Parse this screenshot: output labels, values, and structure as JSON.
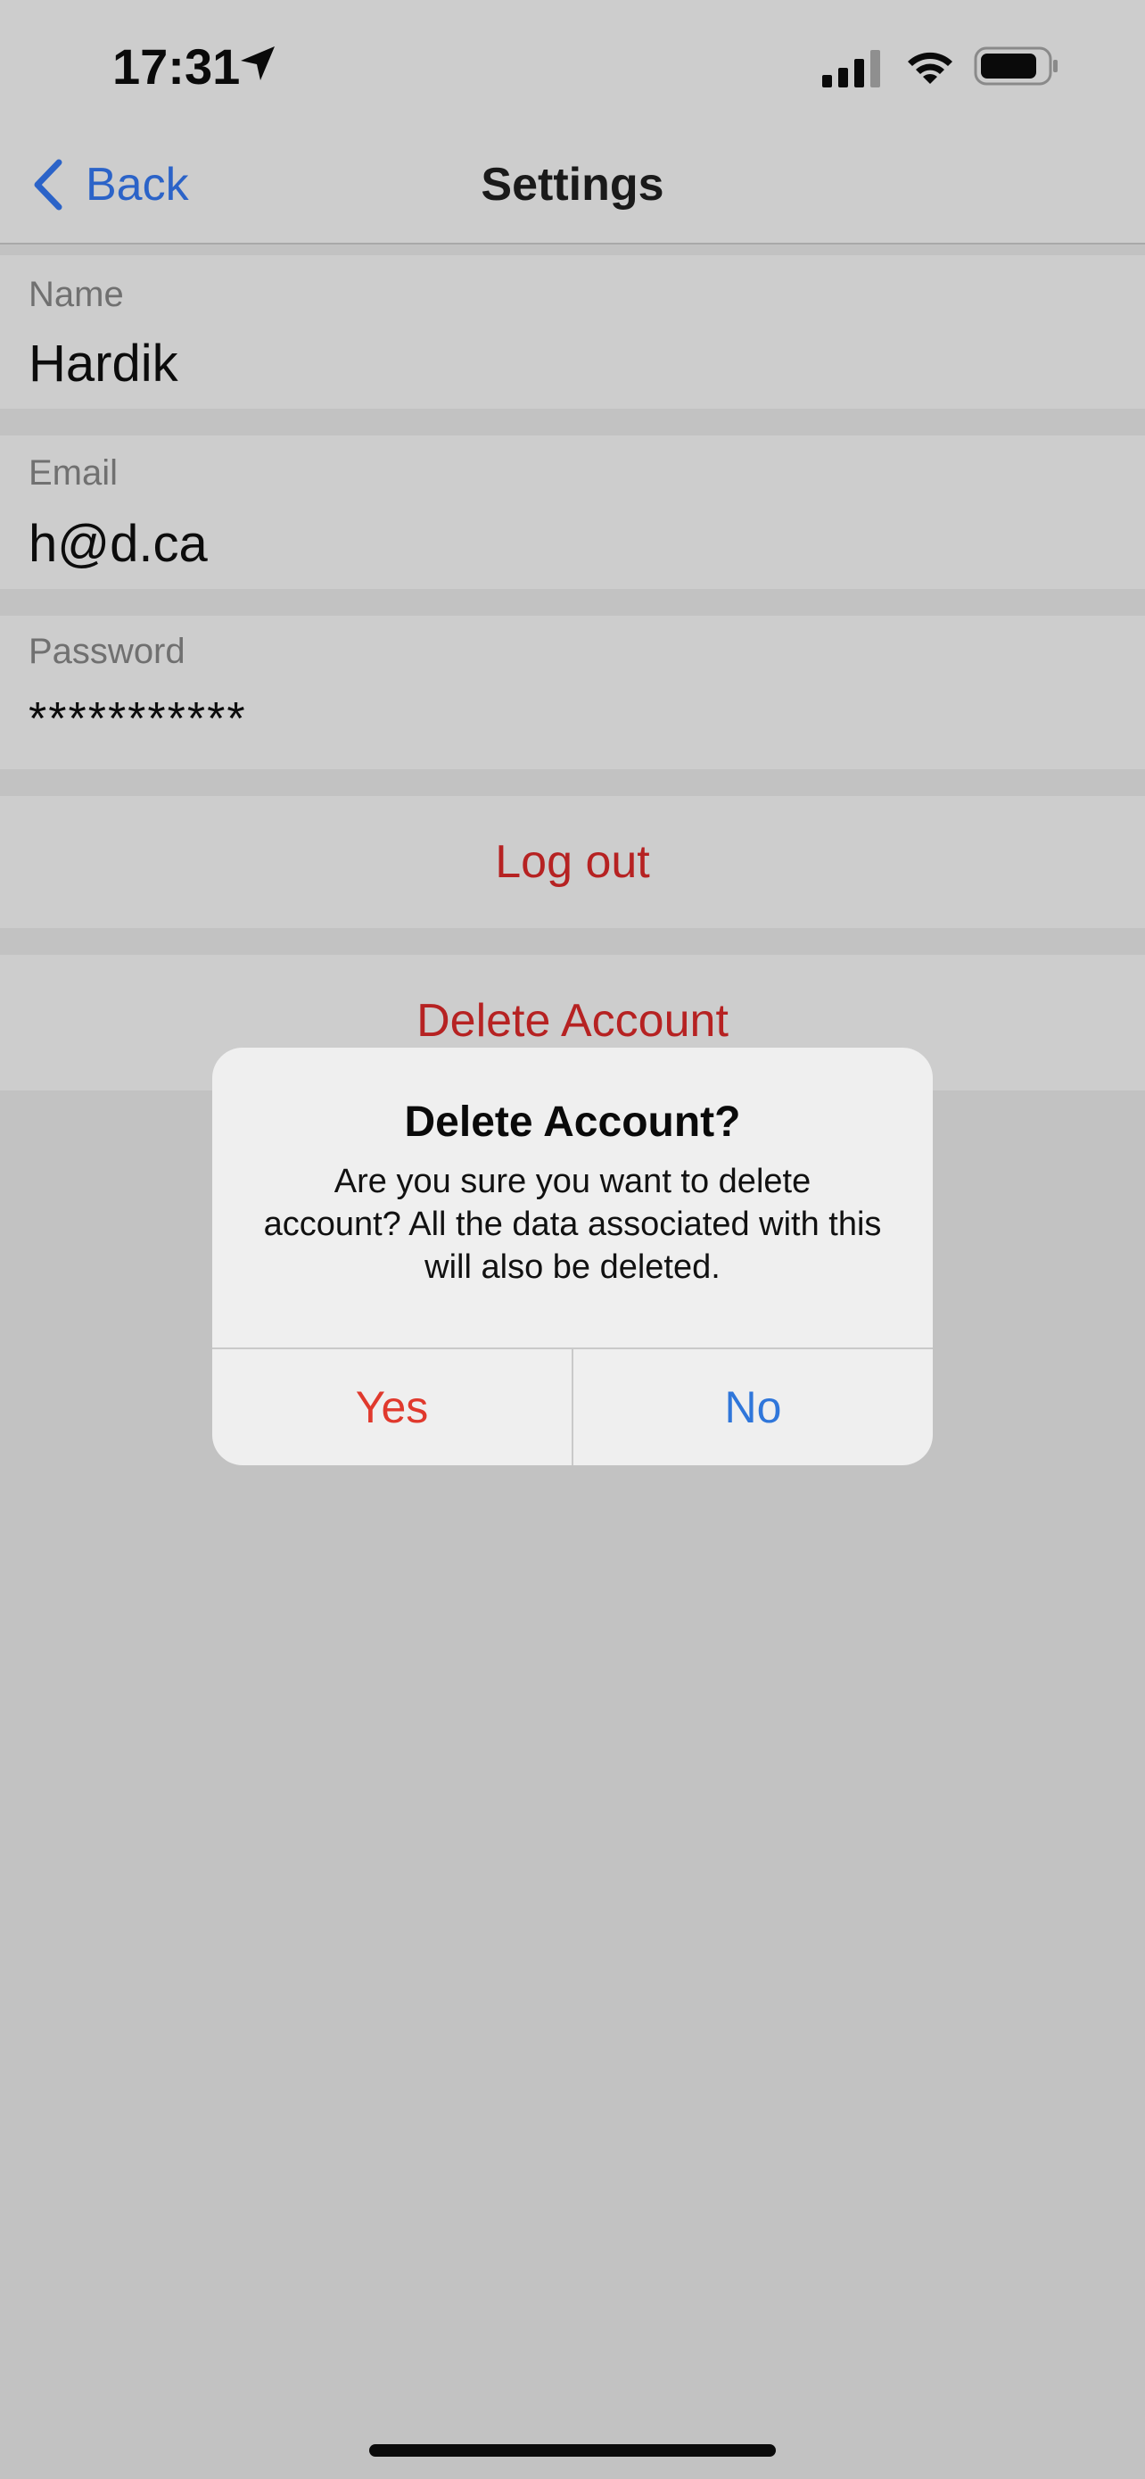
{
  "status_bar": {
    "time": "17:31",
    "location_icon": "location-arrow-icon",
    "signal_icon": "cellular-signal-icon",
    "wifi_icon": "wifi-icon",
    "battery_icon": "battery-icon"
  },
  "nav": {
    "back_label": "Back",
    "back_icon": "chevron-left-icon",
    "title": "Settings"
  },
  "fields": {
    "name": {
      "label": "Name",
      "value": "Hardik"
    },
    "email": {
      "label": "Email",
      "value": "h@d.ca"
    },
    "password": {
      "label": "Password",
      "value": "***********"
    }
  },
  "actions": {
    "logout_label": "Log out",
    "delete_label": "Delete Account"
  },
  "alert": {
    "title": "Delete Account?",
    "message": "Are you sure you want to delete account? All the data associated with this will also be deleted.",
    "yes_label": "Yes",
    "no_label": "No"
  },
  "colors": {
    "accent_blue": "#2b63c8",
    "destructive_red": "#b62222",
    "alert_yes_red": "#e0392d",
    "alert_no_blue": "#2f76da",
    "dim_background": "#c2c2c2"
  }
}
